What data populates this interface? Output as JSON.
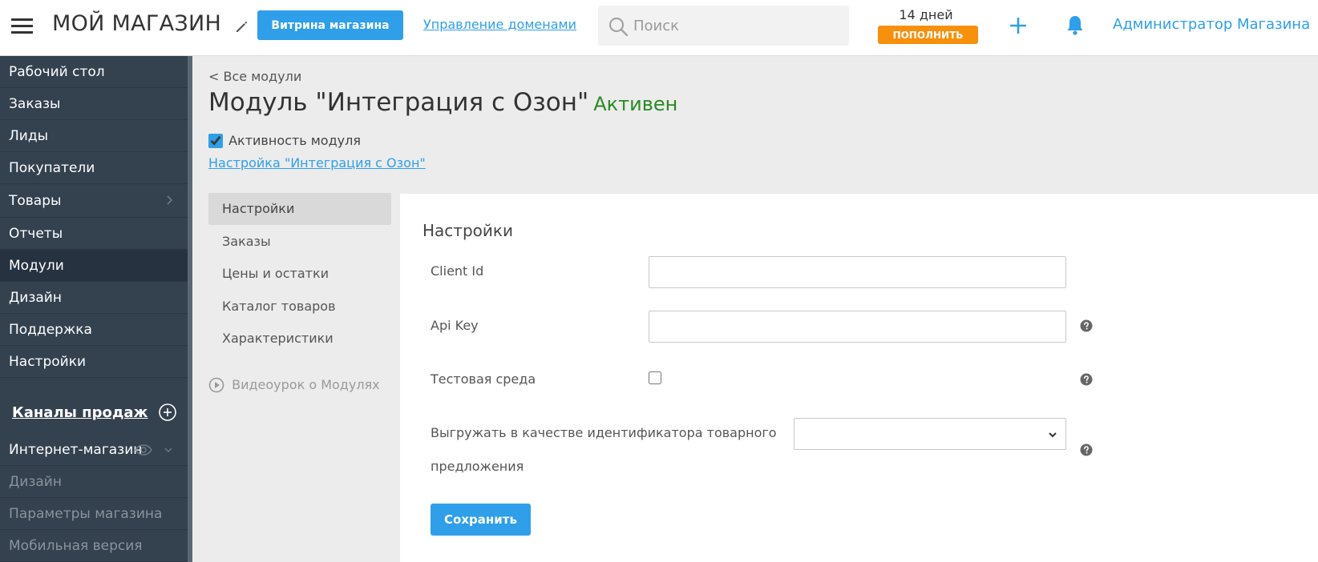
{
  "header": {
    "store_title": "МОЙ МАГАЗИН",
    "storefront_button": "Витрина магазина",
    "domains_link": "Управление доменами",
    "search_placeholder": "Поиск",
    "trial_days": "14 дней",
    "topup_button": "ПОПОЛНИТЬ",
    "admin_user": "Администратор Магазина"
  },
  "sidebar": {
    "items": [
      {
        "label": "Рабочий стол"
      },
      {
        "label": "Заказы"
      },
      {
        "label": "Лиды"
      },
      {
        "label": "Покупатели"
      },
      {
        "label": "Товары"
      },
      {
        "label": "Отчеты"
      },
      {
        "label": "Модули",
        "active": true
      },
      {
        "label": "Дизайн"
      },
      {
        "label": "Поддержка"
      },
      {
        "label": "Настройки"
      }
    ],
    "channels_title": "Каналы продаж",
    "shop_channel": "Интернет-магазин",
    "shop_subitems": [
      {
        "label": "Дизайн"
      },
      {
        "label": "Параметры магазина"
      },
      {
        "label": "Мобильная версия"
      }
    ]
  },
  "main": {
    "back_link": "< Все модули",
    "title": "Модуль \"Интеграция с Озон\"",
    "status": "Активен",
    "status_color": "#2a8a24",
    "activity_label": "Активность модуля",
    "activity_checked": true,
    "settings_link": "Настройка \"Интеграция с Озон\"",
    "subnav": [
      {
        "label": "Настройки",
        "active": true
      },
      {
        "label": "Заказы"
      },
      {
        "label": "Цены и остатки"
      },
      {
        "label": "Каталог товаров"
      },
      {
        "label": "Характеристики"
      }
    ],
    "video_lesson": "Видеоурок о Модулях"
  },
  "panel": {
    "title": "Настройки",
    "client_id_label": "Client Id",
    "client_id_value": "",
    "api_key_label": "Api Key",
    "api_key_value": "",
    "test_env_label": "Тестовая среда",
    "test_env_checked": false,
    "offer_id_label_line1": "Выгружать в качестве идентификатора товарного",
    "offer_id_label_line2": "предложения",
    "offer_id_selected": "",
    "save_button": "Сохранить"
  },
  "colors": {
    "accent": "#2f9fe9",
    "topup": "#f7900d",
    "sidebar_bg": "#34414f",
    "sidebar_active": "#263240"
  },
  "icons": [
    "menu-icon",
    "pencil-icon",
    "search-icon",
    "plus-icon",
    "bell-icon",
    "chevron-down-icon",
    "chevron-right-icon",
    "add-circle-icon",
    "eye-icon",
    "play-circle-icon",
    "help-icon"
  ]
}
